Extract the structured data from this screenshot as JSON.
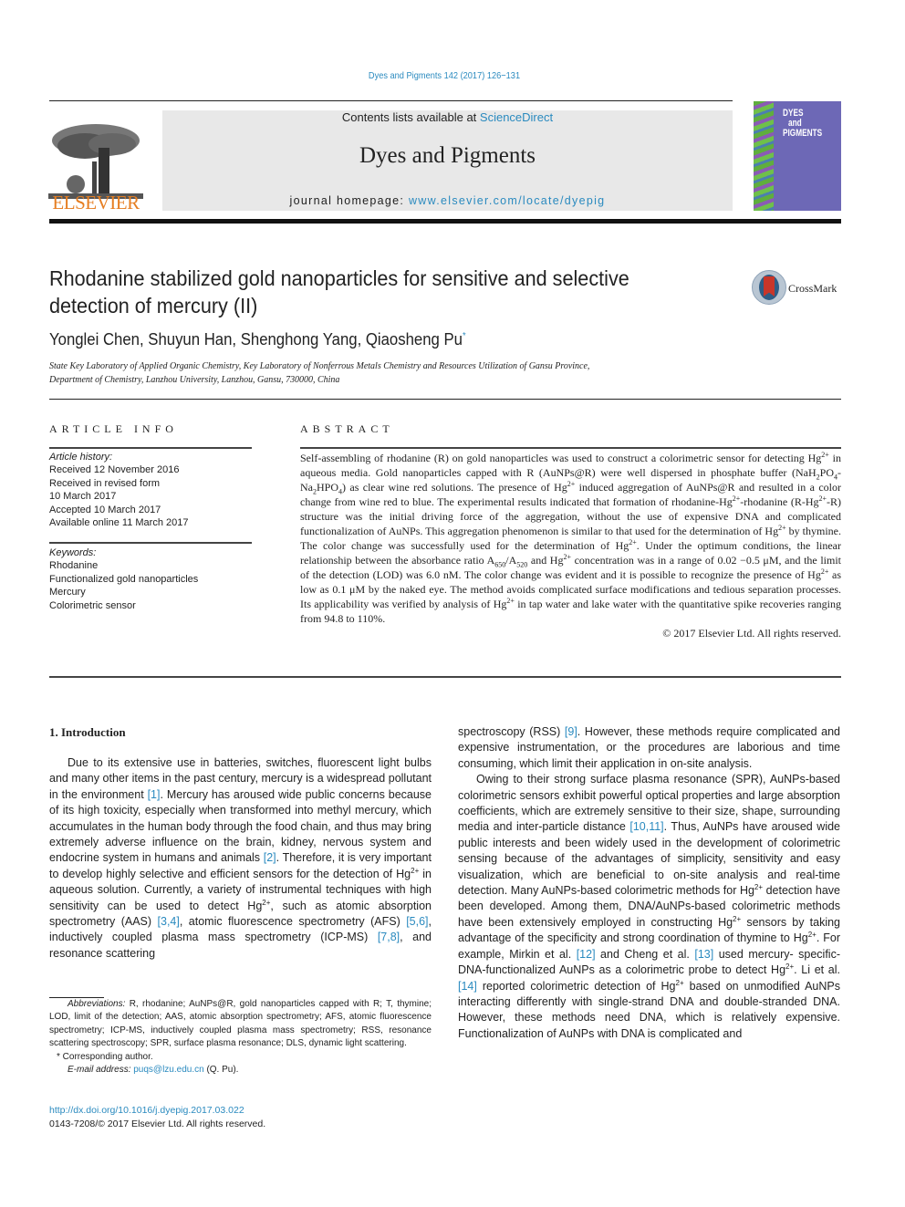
{
  "header": {
    "citation": "Dyes and Pigments 142 (2017) 126−131",
    "contents_prefix": "Contents lists available at ",
    "contents_link": "ScienceDirect",
    "journal_title": "Dyes and Pigments",
    "homepage_prefix": "journal homepage: ",
    "homepage_url": "www.elsevier.com/locate/dyepig",
    "publisher_logo_text": "ELSEVIER",
    "cover_title_lines": [
      "DYES",
      "and",
      "PIGMENTS"
    ],
    "crossmark_label": "CrossMark"
  },
  "colors": {
    "link": "#2a8abf",
    "elsevier_orange": "#e67e22",
    "masthead_gray": "#e8e8e8",
    "cover_purple": "#6d68b6"
  },
  "article": {
    "title_line1": "Rhodanine stabilized gold nanoparticles for sensitive and selective",
    "title_line2": "detection of mercury (II)",
    "authors": "Yonglei Chen, Shuyun Han, Shenghong Yang, Qiaosheng Pu",
    "corresponding_mark": "*",
    "affiliation_line1": "State Key Laboratory of Applied Organic Chemistry, Key Laboratory of Nonferrous Metals Chemistry and Resources Utilization of Gansu Province,",
    "affiliation_line2": "Department of Chemistry, Lanzhou University, Lanzhou, Gansu, 730000, China"
  },
  "article_info": {
    "heading": "ARTICLE INFO",
    "history_label": "Article history:",
    "history": [
      "Received 12 November 2016",
      "Received in revised form",
      "10 March 2017",
      "Accepted 10 March 2017",
      "Available online 11 March 2017"
    ],
    "keywords_label": "Keywords:",
    "keywords": [
      "Rhodanine",
      "Functionalized gold nanoparticles",
      "Mercury",
      "Colorimetric sensor"
    ]
  },
  "abstract": {
    "heading": "ABSTRACT",
    "s1": "Self-assembling of rhodanine (R) on gold nanoparticles was used to construct a colorimetric sensor for detecting Hg",
    "s2": " in aqueous media. Gold nanoparticles capped with R (AuNPs@R) were well dispersed in phosphate buffer (NaH",
    "s3": "PO",
    "s4": "-Na",
    "s5": "HPO",
    "s6": ") as clear wine red solutions. The presence of Hg",
    "s7": " induced aggregation of AuNPs@R and resulted in a color change from wine red to blue. The experimental results indicated that formation of rhodanine-Hg",
    "s8": "-rhodanine (R-Hg",
    "s9": "-R) structure was the initial driving force of the aggregation, without the use of expensive DNA and complicated functionalization of AuNPs. This aggregation phenomenon is similar to that used for the determination of Hg",
    "s10": " by thymine. The color change was successfully used for the determination of Hg",
    "s11": ". Under the optimum conditions, the linear relationship between the absorbance ratio A",
    "s12": "/A",
    "s13": " and Hg",
    "s14": " concentration was in a range of 0.02 −0.5 μM, and the limit of the detection (LOD) was 6.0 nM. The color change was evident and it is possible to recognize the presence of Hg",
    "s15": " as low as 0.1 μM by the naked eye. The method avoids complicated surface modifications and tedious separation processes. Its applicability was verified by analysis of Hg",
    "s16": " in tap water and lake water with the quantitative spike recoveries ranging from 94.8 to 110%.",
    "charge": "2+",
    "sub2": "2",
    "sub4": "4",
    "sub650": "650",
    "sub520": "520",
    "copyright": "© 2017 Elsevier Ltd. All rights reserved."
  },
  "introduction": {
    "heading": "1.  Introduction",
    "left": {
      "a": "Due to its extensive use in batteries, switches, fluorescent light bulbs and many other items in the past century, mercury is a widespread pollutant in the environment ",
      "ref1": "[1]",
      "b": ". Mercury has aroused wide public concerns because of its high toxicity, especially when transformed into methyl mercury, which accumulates in the human body through the food chain, and thus may bring extremely adverse influence on the brain, kidney, nervous system and endocrine system in humans and animals ",
      "ref2": "[2]",
      "c": ". Therefore, it is very important to develop highly selective and efficient sensors for the detection of Hg",
      "d": " in aqueous solution. Currently, a variety of instrumental techniques with high sensitivity can be used to detect Hg",
      "e": ", such as atomic absorption spectrometry (AAS) ",
      "ref34": "[3,4]",
      "f": ", atomic fluorescence spectrometry (AFS) ",
      "ref56": "[5,6]",
      "g": ", inductively coupled plasma mass spectrometry (ICP-MS) ",
      "ref78": "[7,8]",
      "h": ", and resonance scattering"
    },
    "right": {
      "a": "spectroscopy (RSS) ",
      "ref9": "[9]",
      "b": ". However, these methods require complicated and expensive instrumentation, or the procedures are laborious and time consuming, which limit their application in on-site analysis.",
      "p2a": "Owing to their strong surface plasma resonance (SPR), AuNPs-based colorimetric sensors exhibit powerful optical properties and large absorption coefficients, which are extremely sensitive to their size, shape, surrounding media and inter-particle distance ",
      "ref1011": "[10,11]",
      "p2b": ". Thus, AuNPs have aroused wide public interests and been widely used in the development of colorimetric sensing because of the advantages of simplicity, sensitivity and easy visualization, which are beneficial to on-site analysis and real-time detection. Many AuNPs-based colorimetric methods for Hg",
      "p2c": " detection have been developed. Among them, DNA/AuNPs-based colorimetric methods have been extensively employed in constructing Hg",
      "p2d": " sensors by taking advantage of the specificity and strong coordination of thymine to Hg",
      "p2e": ". For example, Mirkin et al. ",
      "ref12": "[12]",
      "p2f": " and Cheng et al. ",
      "ref13": "[13]",
      "p2g": " used mercury- specific-DNA-functionalized AuNPs as a colorimetric probe to detect Hg",
      "p2h": ". Li et al. ",
      "ref14": "[14]",
      "p2i": " reported colorimetric detection of Hg",
      "p2j": " based on unmodified AuNPs interacting differently with single-strand DNA and double-stranded DNA. However, these methods need DNA, which is relatively expensive. Functionalization of AuNPs with DNA is complicated and"
    }
  },
  "footnotes": {
    "abbrev_label": "Abbreviations:",
    "abbrev_text": " R, rhodanine; AuNPs@R, gold nanoparticles capped with R; T, thymine; LOD, limit of the detection; AAS, atomic absorption spectrometry; AFS, atomic fluorescence spectrometry; ICP-MS, inductively coupled plasma mass spectrometry; RSS, resonance scattering spectroscopy; SPR, surface plasma resonance; DLS, dynamic light scattering.",
    "corresponding": "* Corresponding author.",
    "email_label": "E-mail address:",
    "email": "puqs@lzu.edu.cn",
    "email_suffix": " (Q. Pu).",
    "doi": "http://dx.doi.org/10.1016/j.dyepig.2017.03.022",
    "issn": "0143-7208/© 2017 Elsevier Ltd. All rights reserved."
  }
}
